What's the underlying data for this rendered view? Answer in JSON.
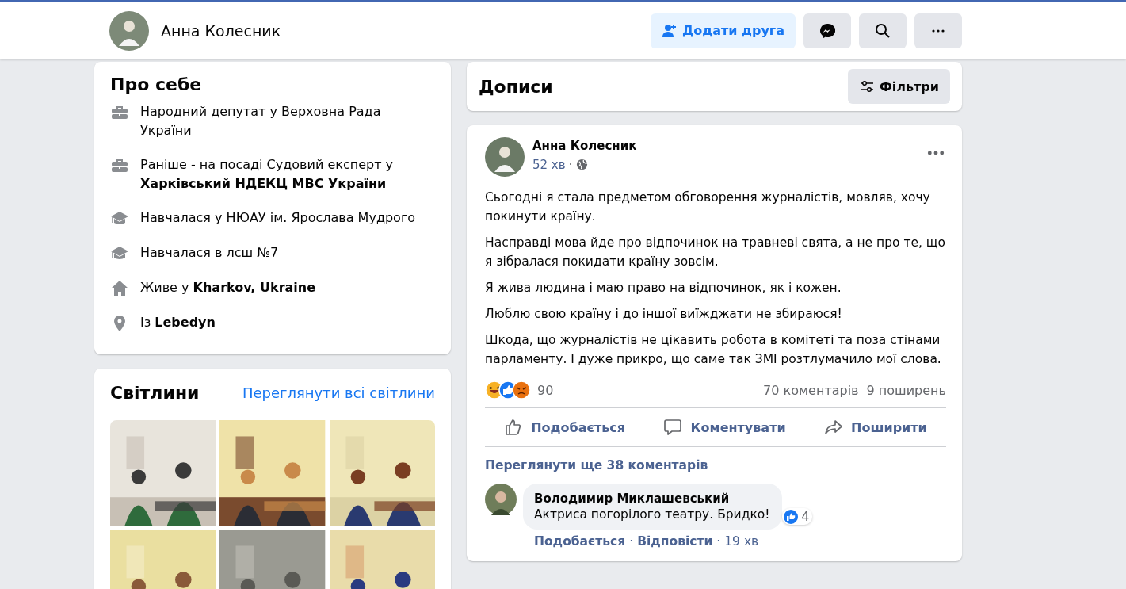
{
  "header": {
    "name": "Анна Колесник",
    "add_friend": "Додати друга"
  },
  "about": {
    "title": "Про себе",
    "items": [
      {
        "kind": "work",
        "text": "Народний депутат у Верховна Рада України"
      },
      {
        "kind": "work",
        "text": "Раніше - на посаді Судовий експерт у **Харківський НДЕКЦ МВС України**"
      },
      {
        "kind": "education",
        "text": "Навчалася у НЮАУ ім. Ярослава Мудрого"
      },
      {
        "kind": "education",
        "text": "Навчалася в лсш №7"
      },
      {
        "kind": "home",
        "text": "Живе у **Kharkov, Ukraine**"
      },
      {
        "kind": "place",
        "text": "Із **Lebedyn**"
      }
    ]
  },
  "photos": {
    "title": "Світлини",
    "link": "Переглянути всі світлини"
  },
  "posts_header": {
    "title": "Дописи",
    "filters": "Фільтри"
  },
  "post": {
    "author": "Анна Колесник",
    "time": "52 хв",
    "time_separator": "·",
    "paragraphs": [
      "Сьогодні я стала предметом обговорення журналістів, мовляв, хочу покинути країну.",
      "Насправді мова йде про відпочинок на травневі свята, а не про те, що я зібралася покидати країну зовсім.",
      "Я жива людина і маю право на відпочинок, як і кожен.",
      "Люблю свою країну і до іншої виїжджати не збираюся!",
      "Шкода, що журналістів не цікавить робота в комітеті та поза стінами парламенту. І дуже прикро, що саме так ЗМІ розтлумачило мої слова."
    ],
    "reactions": "90",
    "comments": "70 коментарів",
    "shares": "9 поширень",
    "actions": [
      {
        "kind": "like",
        "label": "Подобається"
      },
      {
        "kind": "comment",
        "label": "Коментувати"
      },
      {
        "kind": "share",
        "label": "Поширити"
      }
    ],
    "more_comments": "Переглянути ще 38 коментарів",
    "comment": {
      "author": "Володимир Миклашевський",
      "text": "Актриса погорілого театру. Бридко!",
      "likes": "4",
      "like": "Подобається",
      "separators": [
        "·",
        "·"
      ],
      "reply": "Відповісти",
      "time": "19 хв"
    }
  }
}
